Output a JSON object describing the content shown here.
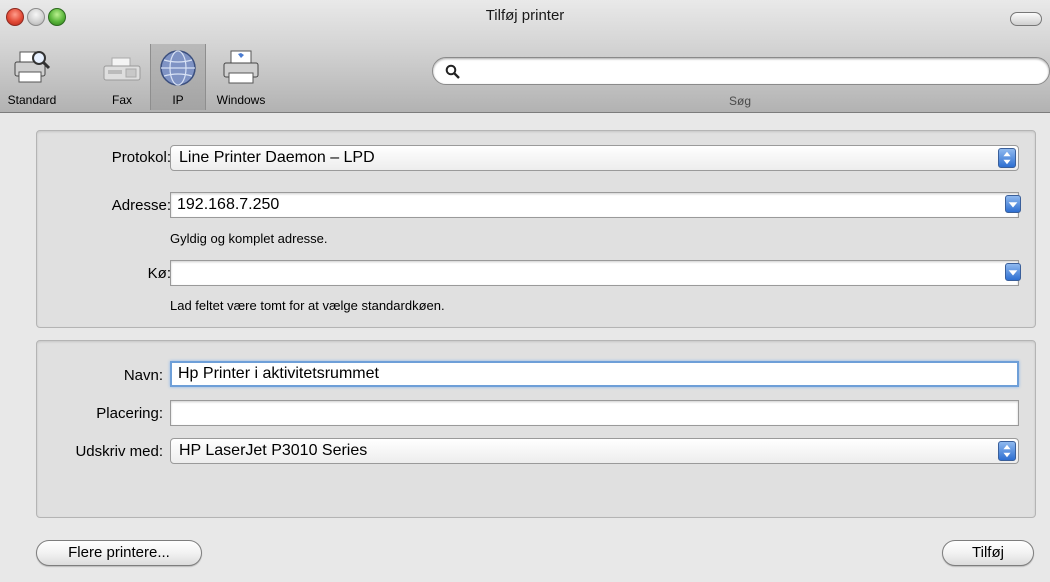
{
  "window": {
    "title": "Tilføj printer"
  },
  "toolbar": {
    "items": [
      {
        "label": "Standard",
        "icon": "printer-magnifier-icon"
      },
      {
        "label": "Fax",
        "icon": "fax-icon"
      },
      {
        "label": "IP",
        "icon": "globe-icon",
        "selected": true
      },
      {
        "label": "Windows",
        "icon": "windows-printer-icon"
      }
    ],
    "search": {
      "label": "Søg",
      "value": "",
      "placeholder": ""
    }
  },
  "connection": {
    "protocol": {
      "label": "Protokol:",
      "value": "Line Printer Daemon – LPD"
    },
    "address": {
      "label": "Adresse:",
      "value": "192.168.7.250",
      "hint": "Gyldig og komplet adresse."
    },
    "queue": {
      "label": "Kø:",
      "value": "",
      "hint": "Lad feltet være tomt for at vælge standardkøen."
    }
  },
  "printer": {
    "name": {
      "label": "Navn:",
      "value": "Hp Printer i aktivitetsrummet"
    },
    "location": {
      "label": "Placering:",
      "value": ""
    },
    "driver": {
      "label": "Udskriv med:",
      "value": "HP LaserJet P3010 Series"
    }
  },
  "buttons": {
    "more_printers": "Flere printere...",
    "add": "Tilføj"
  },
  "colors": {
    "accent": "#2e6fd1",
    "focus_ring": "#6e9fd8"
  }
}
